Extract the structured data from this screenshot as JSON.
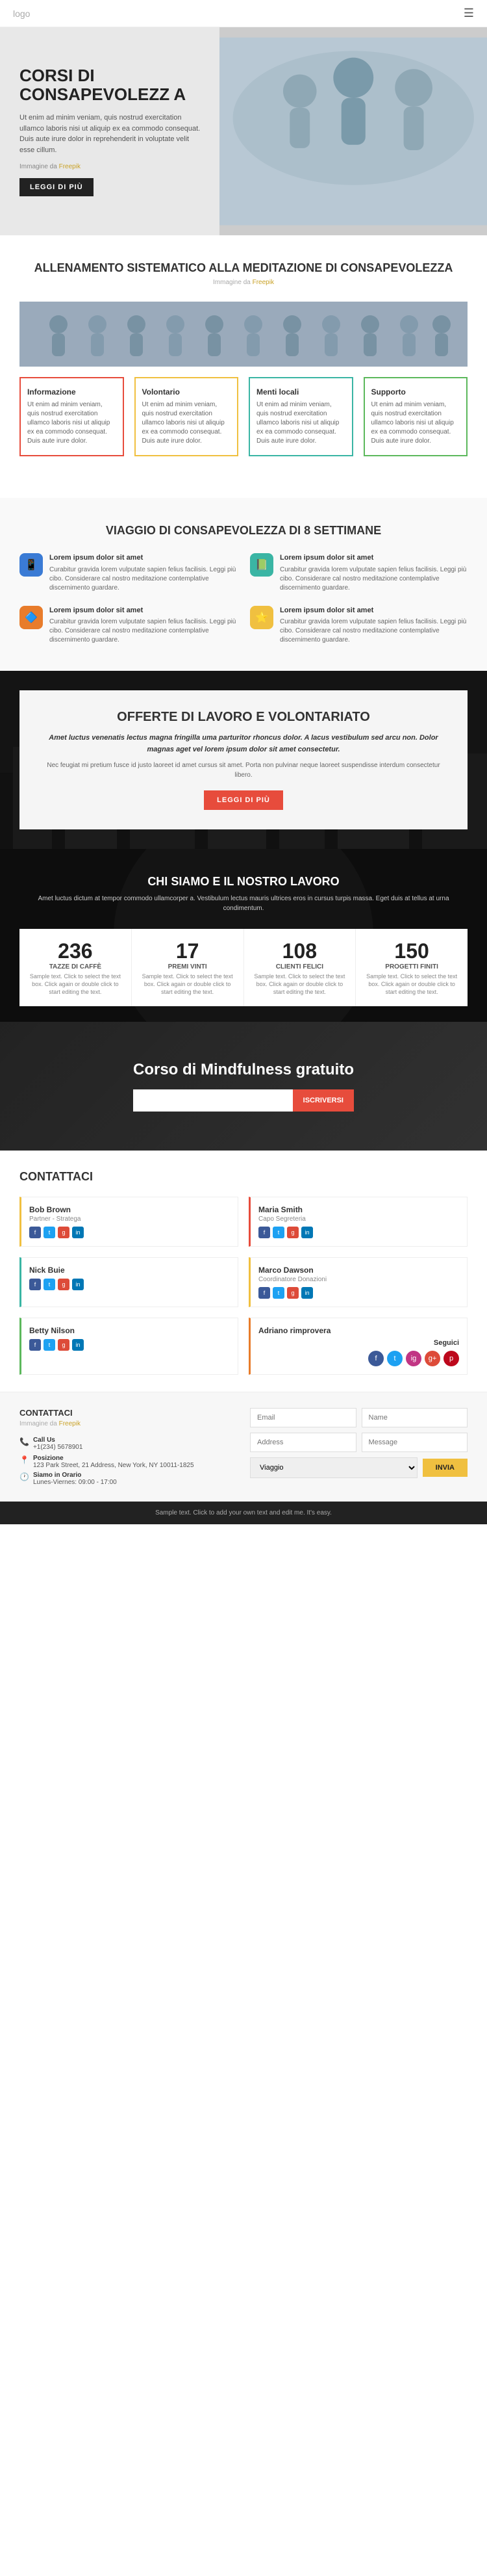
{
  "navbar": {
    "logo": "logo",
    "menu_icon": "☰"
  },
  "hero": {
    "title": "CORSI DI CONSAPEVOLEZZ A",
    "text": "Ut enim ad minim veniam, quis nostrud exercitation ullamco laboris nisi ut aliquip ex ea commodo consequat. Duis aute irure dolor in reprehenderit in voluptate velit esse cillum.",
    "img_label": "Immagine da",
    "img_link": "Freepik",
    "btn": "LEGGI DI PIÙ"
  },
  "section2": {
    "title": "ALLENAMENTO SISTEMATICO ALLA MEDITAZIONE DI CONSAPEVOLEZZA",
    "sub_label": "Immagine da",
    "sub_link": "Freepik",
    "cards": [
      {
        "id": "red",
        "title": "Informazione",
        "text": "Ut enim ad minim veniam, quis nostrud exercitation ullamco laboris nisi ut aliquip ex ea commodo consequat. Duis aute irure dolor."
      },
      {
        "id": "yellow",
        "title": "Volontario",
        "text": "Ut enim ad minim veniam, quis nostrud exercitation ullamco laboris nisi ut aliquip ex ea commodo consequat. Duis aute irure dolor."
      },
      {
        "id": "teal",
        "title": "Menti locali",
        "text": "Ut enim ad minim veniam, quis nostrud exercitation ullamco laboris nisi ut aliquip ex ea commodo consequat. Duis aute irure dolor."
      },
      {
        "id": "green",
        "title": "Supporto",
        "text": "Ut enim ad minim veniam, quis nostrud exercitation ullamco laboris nisi ut aliquip ex ea commodo consequat. Duis aute irure dolor."
      }
    ]
  },
  "section3": {
    "title": "VIAGGIO DI CONSAPEVOLEZZA DI 8 SETTIMANE",
    "items": [
      {
        "icon": "📱",
        "color": "blue",
        "title": "Lorem ipsum dolor sit amet",
        "text": "Curabitur gravida lorem vulputate sapien felius facilisis. Leggi più cibo. Considerare cal nostro meditazione contemplative discernimento guardare."
      },
      {
        "icon": "📗",
        "color": "teal",
        "title": "Lorem ipsum dolor sit amet",
        "text": "Curabitur gravida lorem vulputate sapien felius facilisis. Leggi più cibo. Considerare cal nostro meditazione contemplative discernimento guardare."
      },
      {
        "icon": "🔷",
        "color": "orange",
        "title": "Lorem ipsum dolor sit amet",
        "text": "Curabitur gravida lorem vulputate sapien felius facilisis. Leggi più cibo. Considerare cal nostro meditazione contemplative discernimento guardare."
      },
      {
        "icon": "⭐",
        "color": "yellow",
        "title": "Lorem ipsum dolor sit amet",
        "text": "Curabitur gravida lorem vulputate sapien felius facilisis. Leggi più cibo. Considerare cal nostro meditazione contemplative discernimento guardare."
      }
    ]
  },
  "section4": {
    "title": "OFFERTE DI LAVORO E VOLONTARIATO",
    "subtitle": "Amet luctus venenatis lectus magna fringilla uma parturitor rhoncus dolor. A lacus vestibulum sed arcu non. Dolor magnas aget vel lorem ipsum dolor sit amet consectetur.",
    "text": "Nec feugiat mi pretium fusce id justo laoreet id amet cursus sit amet. Porta non pulvinar neque laoreet suspendisse interdum consectetur libero.",
    "btn": "LEGGI DI PIÙ"
  },
  "section5": {
    "title": "CHI SIAMO E IL NOSTRO LAVORO",
    "text": "Amet luctus dictum at tempor commodo ullamcorper a. Vestibulum lectus mauris ultrices eros in cursus turpis massa. Eget duis at tellus at urna condimentum.",
    "stats": [
      {
        "number": "236",
        "label": "TAZZE DI CAFFÈ",
        "desc": "Sample text. Click to select the text box. Click again or double click to start editing the text."
      },
      {
        "number": "17",
        "label": "PREMI VINTI",
        "desc": "Sample text. Click to select the text box. Click again or double click to start editing the text."
      },
      {
        "number": "108",
        "label": "CLIENTI FELICI",
        "desc": "Sample text. Click to select the text box. Click again or double click to start editing the text."
      },
      {
        "number": "150",
        "label": "PROGETTI FINITI",
        "desc": "Sample text. Click to select the text box. Click again or double click to start editing the text."
      }
    ]
  },
  "section6": {
    "title": "Corso di Mindfulness gratuito",
    "input_placeholder": "",
    "btn": "ISCRIVERSI"
  },
  "section7": {
    "title": "CONTATTACI",
    "contacts": [
      {
        "name": "Bob Brown",
        "role": "Partner - Stratega",
        "border": "yellow-border"
      },
      {
        "name": "Maria Smith",
        "role": "Capo Segreteria",
        "border": "red-border"
      },
      {
        "name": "Nick Buie",
        "role": "",
        "border": "teal-border"
      },
      {
        "name": "Marco Dawson",
        "role": "Coordinatore Donazioni",
        "border": "yellow-border"
      },
      {
        "name": "Betty Nilson",
        "role": "",
        "border": "green-border"
      },
      {
        "name": "Adriano rimprovera",
        "role": "",
        "border": "orange-border"
      }
    ],
    "follow": {
      "title": "Seguici"
    }
  },
  "footer": {
    "title": "CONTATTACI",
    "sub_label": "Immagine da",
    "sub_link": "Freepik",
    "call_label": "Call Us",
    "call_number": "+1(234) 5678901",
    "location_label": "Posizione",
    "location_address": "123 Park Street, 21 Address, New York, NY 10011-1825",
    "hours_label": "Siamo in Orario",
    "hours_value": "Lunes-Viernes: 09:00 - 17:00",
    "form": {
      "email_placeholder": "Email",
      "name_placeholder": "Name",
      "address_placeholder": "Address",
      "message_placeholder": "Message",
      "dropdown_placeholder": "Viaggio",
      "btn": "INVIA"
    },
    "copyright": "Sample text. Click to add your own text and edit me. It's easy."
  }
}
